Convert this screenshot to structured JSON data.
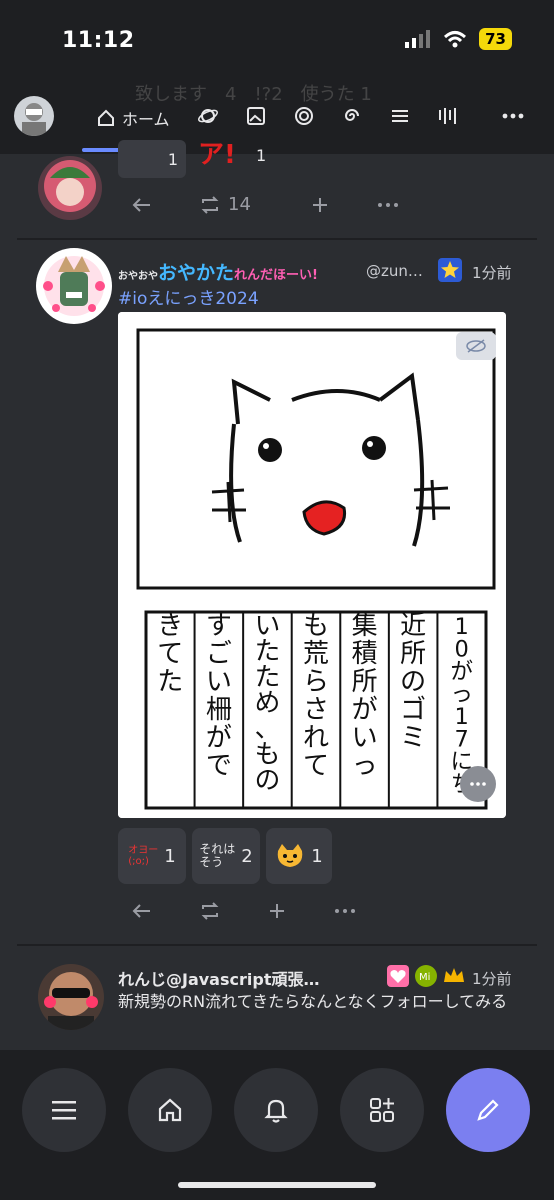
{
  "status": {
    "time": "11:12",
    "battery": "73"
  },
  "nav": {
    "home_label": "ホーム",
    "ghost_text": "致します　4　!?2　使うた 1"
  },
  "post1": {
    "retweet_count": "14",
    "reaction_label": "1",
    "badge_label": "1"
  },
  "post2": {
    "name_prefix": "おやおや",
    "name_main": "おやかた",
    "name_suffix": "れんだほーい!",
    "handle": "@zun…",
    "time": "1分前",
    "hashtag": "#ioえにっき2024",
    "reactions": [
      {
        "label": "オヨー(;o;)",
        "count": "1"
      },
      {
        "label": "それはそう",
        "count": "2"
      },
      {
        "label": "cat",
        "count": "1"
      }
    ],
    "comic_columns": [
      "10がっ17にち",
      "近所のゴミ",
      "集積所がいっ",
      "も荒らされて",
      "いたため、もの",
      "すごい柵がで",
      "きてた"
    ]
  },
  "post3": {
    "name": "れんじ@Javascript頑張…",
    "time": "1分前",
    "text": "新規勢のRN流れてきたらなんとなくフォローしてみる"
  }
}
